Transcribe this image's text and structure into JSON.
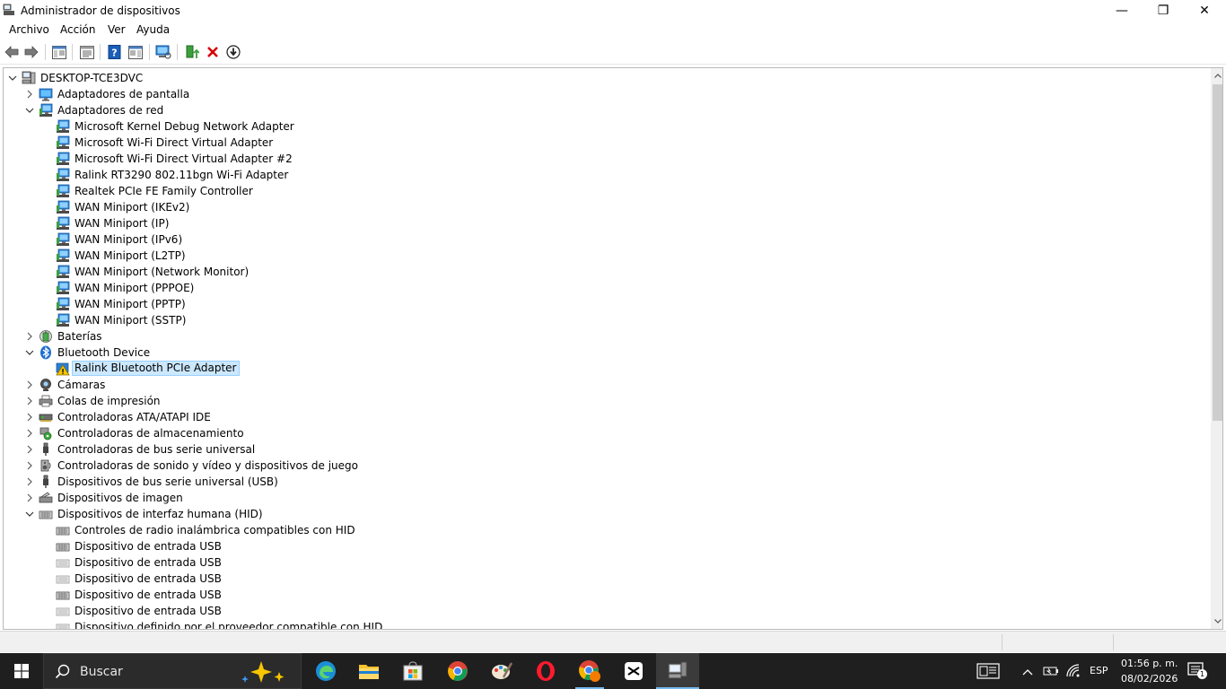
{
  "window": {
    "title": "Administrador de dispositivos",
    "minimize_glyph": "—",
    "maximize_glyph": "❐",
    "close_glyph": "✕"
  },
  "menu": {
    "archivo": "Archivo",
    "accion": "Acción",
    "ver": "Ver",
    "ayuda": "Ayuda"
  },
  "toolbar": {
    "icons": [
      "back-arrow-icon",
      "forward-arrow-icon",
      "show-hide-console-tree-icon",
      "properties-icon",
      "help-icon",
      "action-pane-icon",
      "scan-hardware-changes-icon",
      "update-driver-icon",
      "uninstall-device-icon",
      "download-icon"
    ]
  },
  "tree": {
    "root": "DESKTOP-TCE3DVC",
    "display_adapters": "Adaptadores de pantalla",
    "network_adapters": "Adaptadores de red",
    "network_items": [
      "Microsoft Kernel Debug Network Adapter",
      "Microsoft Wi-Fi Direct Virtual Adapter",
      "Microsoft Wi-Fi Direct Virtual Adapter #2",
      "Ralink RT3290 802.11bgn Wi-Fi Adapter",
      "Realtek PCIe FE Family Controller",
      "WAN Miniport (IKEv2)",
      "WAN Miniport (IP)",
      "WAN Miniport (IPv6)",
      "WAN Miniport (L2TP)",
      "WAN Miniport (Network Monitor)",
      "WAN Miniport (PPPOE)",
      "WAN Miniport (PPTP)",
      "WAN Miniport (SSTP)"
    ],
    "batteries": "Baterías",
    "bluetooth": "Bluetooth Device",
    "bluetooth_item": "Ralink Bluetooth PCIe Adapter",
    "cameras": "Cámaras",
    "print_queues": "Colas de impresión",
    "ata_controllers": "Controladoras ATA/ATAPI IDE",
    "storage_controllers": "Controladoras de almacenamiento",
    "usb_controllers": "Controladoras de bus serie universal",
    "sound_controllers": "Controladoras de sonido y vídeo y dispositivos de juego",
    "usb_devices": "Dispositivos de bus serie universal (USB)",
    "imaging_devices": "Dispositivos de imagen",
    "hid": "Dispositivos de interfaz humana (HID)",
    "hid_items": [
      "Controles de radio inalámbrica compatibles con HID",
      "Dispositivo de entrada USB",
      "Dispositivo de entrada USB",
      "Dispositivo de entrada USB",
      "Dispositivo de entrada USB",
      "Dispositivo de entrada USB",
      "Dispositivo definido por el proveedor compatible con HID"
    ]
  },
  "taskbar": {
    "search_placeholder": "Buscar",
    "language": "ESP",
    "time": "01:56 p. m.",
    "date": "08/02/2026",
    "notification_count": "1"
  },
  "colors": {
    "selection_bg": "#cce8ff",
    "selection_border": "#99d1ff",
    "taskbar_bg": "#1f1f1f",
    "network_icon": "#2a7fd4",
    "uninstall_red": "#d40000",
    "warning_yellow": "#f5c400"
  }
}
